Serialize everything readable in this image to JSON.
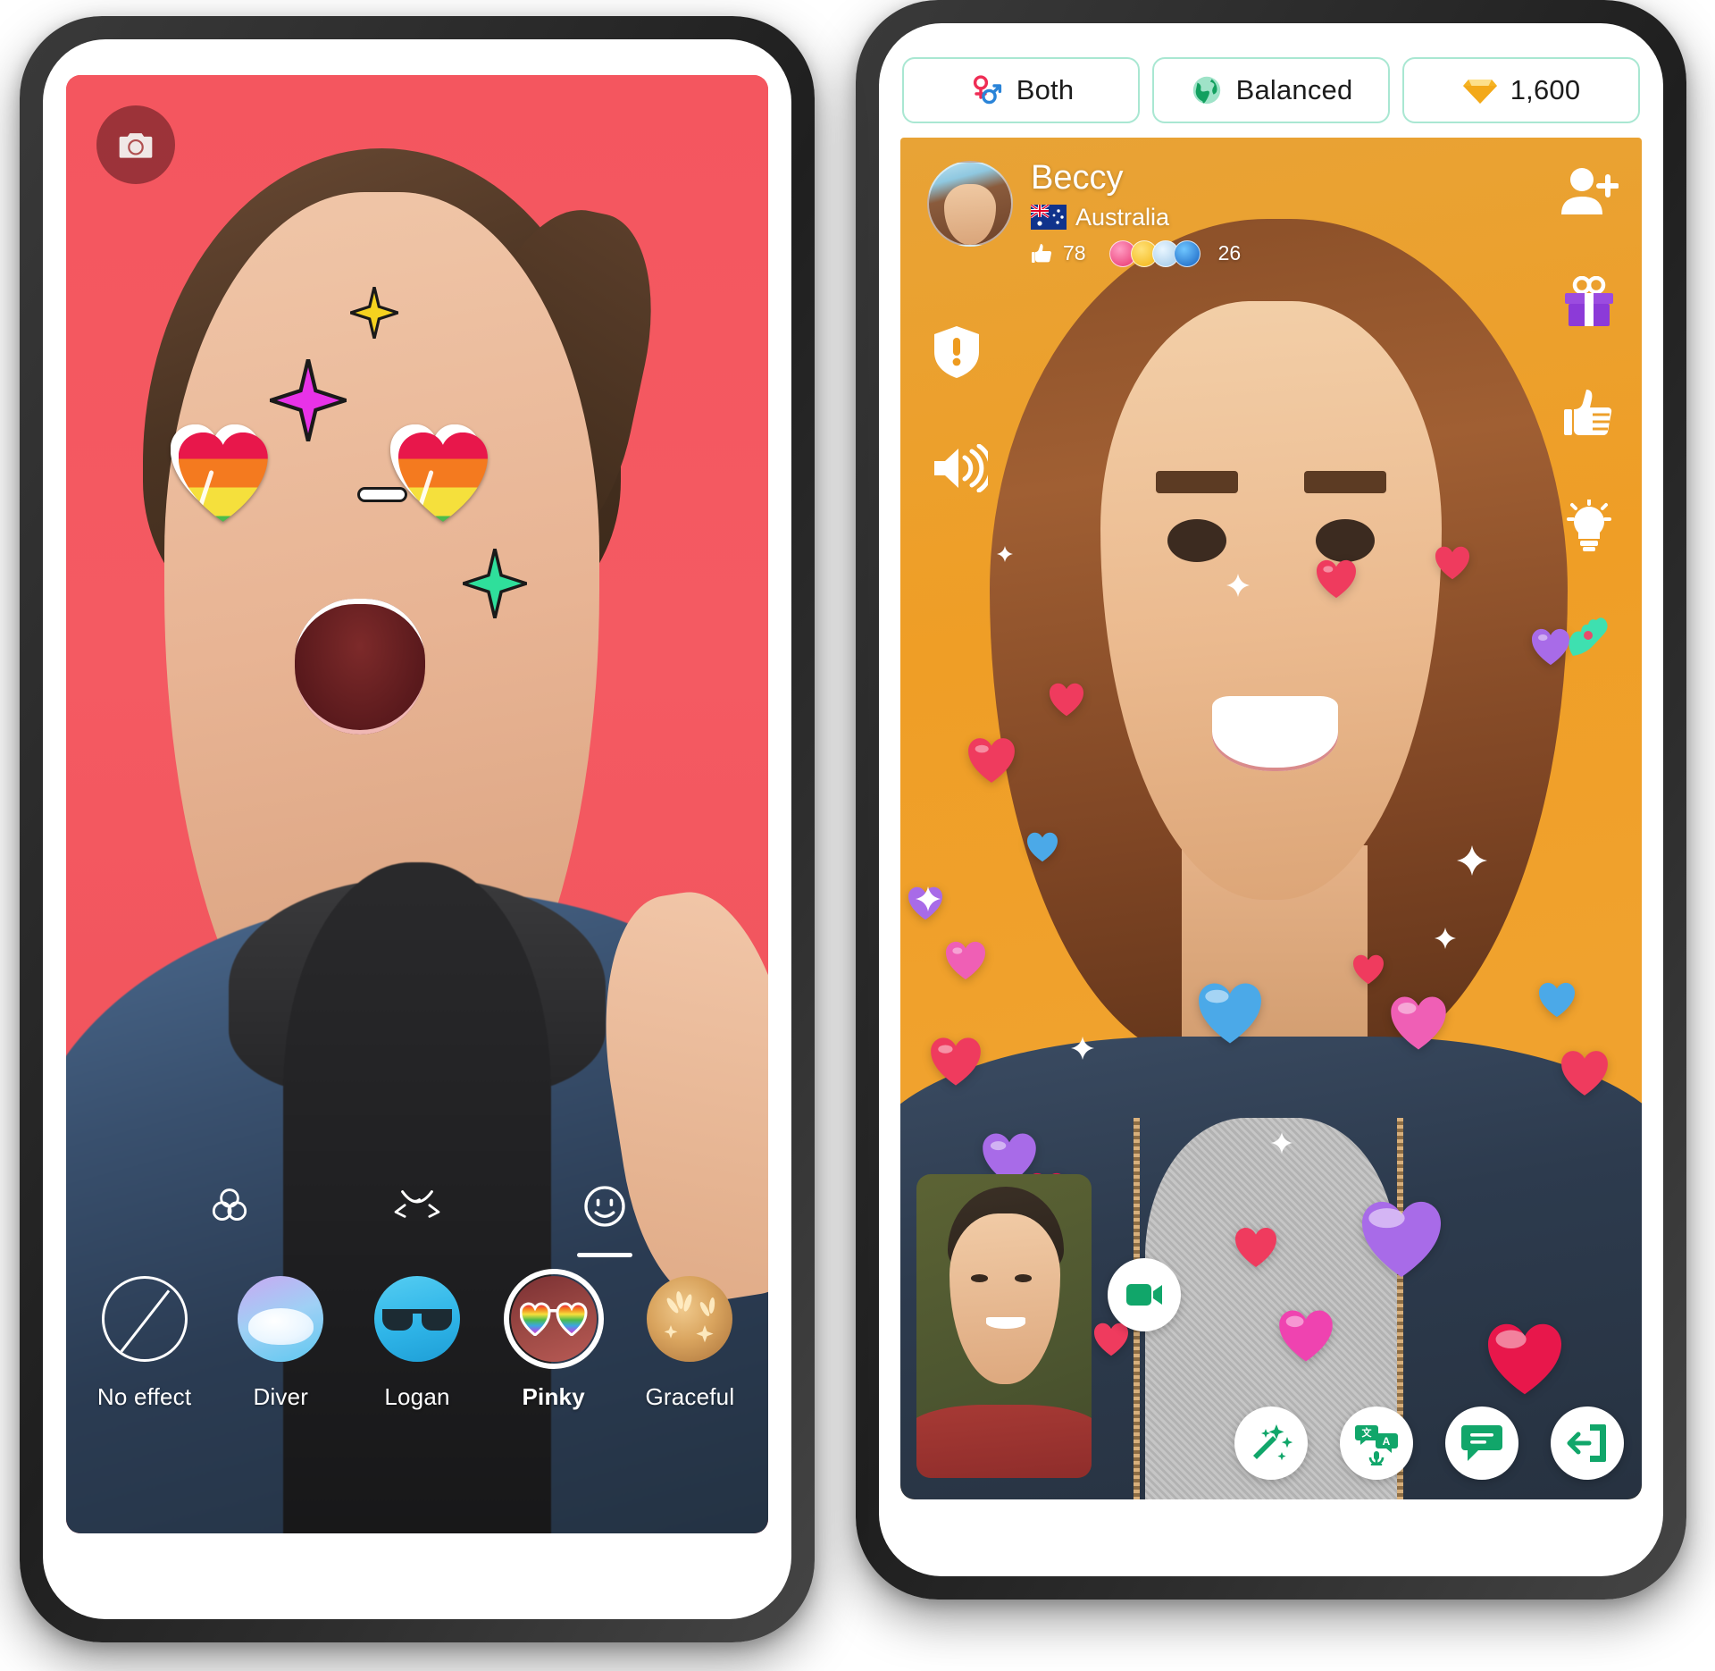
{
  "left_phone": {
    "name": "camera-filter-screen",
    "camera_flip": {
      "icon": "camera-icon",
      "label": "Flip camera"
    },
    "tools": [
      {
        "icon": "color-filter-icon",
        "label": "Filters",
        "active": false
      },
      {
        "icon": "beauty-face-icon",
        "label": "Beauty",
        "active": false
      },
      {
        "icon": "smiley-sticker-icon",
        "label": "Effects",
        "active": true
      }
    ],
    "filters": [
      {
        "label": "No effect",
        "thumb": "no-effect-thumb",
        "selected": false
      },
      {
        "label": "Diver",
        "thumb": "diver-thumb",
        "selected": false
      },
      {
        "label": "Logan",
        "thumb": "logan-thumb",
        "selected": false
      },
      {
        "label": "Pinky",
        "thumb": "pinky-thumb",
        "selected": true
      },
      {
        "label": "Graceful",
        "thumb": "graceful-thumb",
        "selected": false
      }
    ],
    "applied_effect": {
      "name": "rainbow-heart-sunglasses",
      "rainbow_stripes": [
        "#e8174b",
        "#f47a1f",
        "#f5e03c",
        "#4cbb4c",
        "#3ba7e0",
        "#9b5de5",
        "#ef43b0"
      ],
      "sparkles": [
        {
          "name": "sparkle-magenta",
          "color": "#e832e8"
        },
        {
          "name": "sparkle-yellow",
          "color": "#f5d21f"
        },
        {
          "name": "sparkle-green",
          "color": "#2fdf9b"
        }
      ]
    },
    "background_color": "#f2545b"
  },
  "right_phone": {
    "name": "video-chat-screen",
    "topbar": [
      {
        "label": "Both",
        "icon": "gender-both-icon",
        "name": "gender-filter-pill"
      },
      {
        "label": "Balanced",
        "icon": "globe-icon",
        "name": "region-filter-pill"
      },
      {
        "label": "1,600",
        "icon": "gem-icon",
        "name": "gems-balance-pill"
      }
    ],
    "remote_user": {
      "name": "Beccy",
      "country": "Australia",
      "country_flag": "australia-flag",
      "likes": "78",
      "badge_count": "26",
      "badges": [
        "heart-badge",
        "smiley-badge",
        "snowflake-badge",
        "globe-badge"
      ]
    },
    "left_rail": [
      {
        "icon": "report-shield-icon",
        "label": "Report"
      },
      {
        "icon": "speaker-volume-icon",
        "label": "Volume"
      }
    ],
    "right_rail": [
      {
        "icon": "add-friend-icon",
        "label": "Add friend"
      },
      {
        "icon": "gift-icon",
        "label": "Send gift"
      },
      {
        "icon": "thumbs-up-icon",
        "label": "Like"
      },
      {
        "icon": "lightbulb-icon",
        "label": "Hint"
      },
      {
        "icon": "hand-wave-icon",
        "label": "Wave"
      }
    ],
    "bottom_rail": [
      {
        "icon": "camera-toggle-icon",
        "label": "Camera"
      },
      {
        "icon": "magic-wand-icon",
        "label": "Effects"
      },
      {
        "icon": "translate-icon",
        "label": "Translate"
      },
      {
        "icon": "chat-bubble-icon",
        "label": "Chat"
      },
      {
        "icon": "exit-door-icon",
        "label": "Leave chat"
      }
    ],
    "pip": {
      "label": "Your camera preview",
      "name": "self-view"
    },
    "gradient_top": "#e8a336",
    "accent_green": "#11a66a",
    "pill_border": "#a9e7d2",
    "heart_colors": [
      "#ef3b5e",
      "#4ba9e8",
      "#a86be8",
      "#ef5fb5",
      "#e8174b"
    ]
  }
}
